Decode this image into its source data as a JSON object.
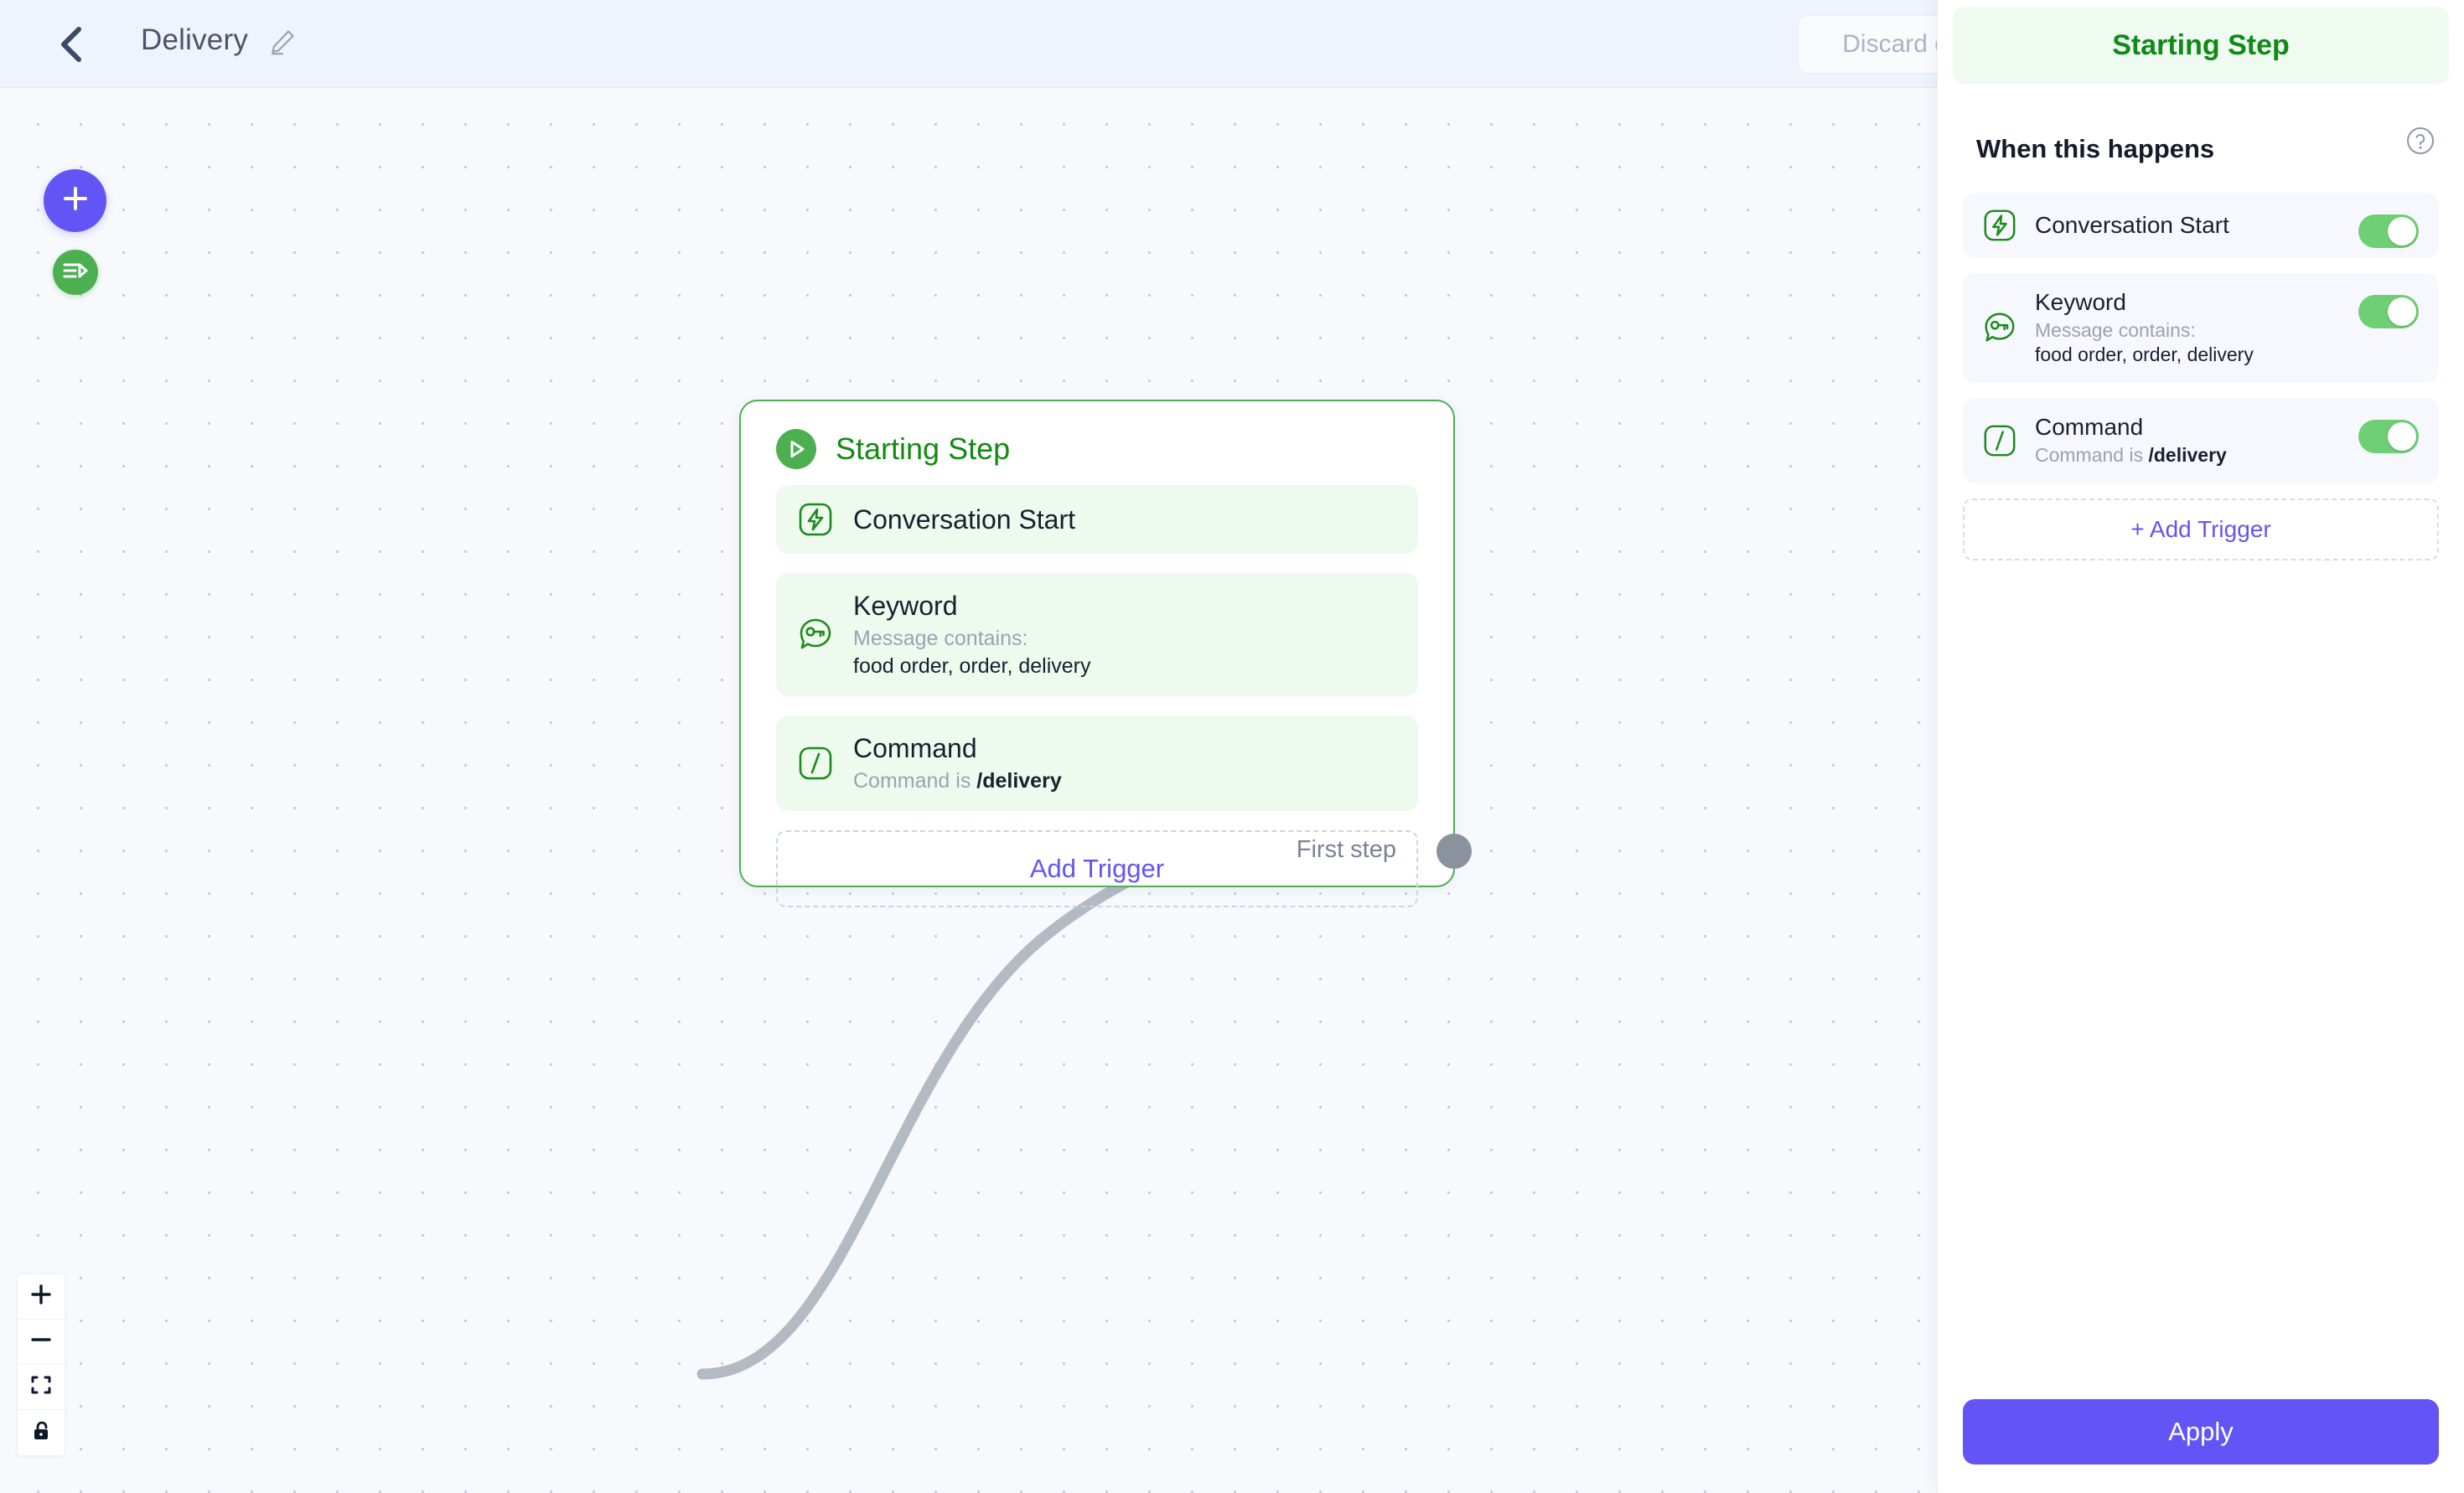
{
  "header": {
    "back_icon": "chevron-left-icon",
    "flow_title": "Delivery",
    "edit_icon": "pencil-icon",
    "discard_label": "Discard changes"
  },
  "canvas": {
    "add_node_icon": "plus-icon",
    "test_flow_icon": "test-flow-icon",
    "zoom_controls": [
      {
        "name": "zoom-in",
        "icon": "plus-icon"
      },
      {
        "name": "zoom-out",
        "icon": "minus-icon"
      },
      {
        "name": "fit-view",
        "icon": "fit-view-icon"
      },
      {
        "name": "lock",
        "icon": "unlock-icon"
      }
    ],
    "node": {
      "title": "Starting Step",
      "title_icon": "play-circle-icon",
      "triggers": [
        {
          "name": "conversation-start",
          "icon": "lightning-bolt-icon",
          "title": "Conversation Start",
          "sub": "",
          "value": ""
        },
        {
          "name": "keyword",
          "icon": "keyword-bubble-icon",
          "title": "Keyword",
          "sub": "Message contains:",
          "value": "food order, order, delivery"
        },
        {
          "name": "command",
          "icon": "slash-command-icon",
          "title": "Command",
          "sub": "Command is ",
          "value": "/delivery"
        }
      ],
      "add_trigger_label": "Add Trigger",
      "first_step_label": "First step"
    }
  },
  "panel": {
    "title": "Starting Step",
    "section_title": "When this happens",
    "help_icon": "question-circle-icon",
    "triggers": [
      {
        "name": "conversation-start",
        "icon": "lightning-bolt-icon",
        "title": "Conversation Start",
        "sub": "",
        "value": "",
        "enabled": true
      },
      {
        "name": "keyword",
        "icon": "keyword-bubble-icon",
        "title": "Keyword",
        "sub": "Message contains:",
        "value": "food order, order, delivery",
        "enabled": true
      },
      {
        "name": "command",
        "icon": "slash-command-icon",
        "title": "Command",
        "sub": "Command is ",
        "value": "/delivery",
        "enabled": true
      }
    ],
    "add_trigger_label": "+ Add Trigger",
    "apply_label": "Apply"
  },
  "colors": {
    "accent_purple": "#6355f5",
    "green": "#4caf50",
    "green_dark": "#138a13",
    "toggle_on": "#6fcf74",
    "canvas_bg": "#f7f9fd"
  }
}
